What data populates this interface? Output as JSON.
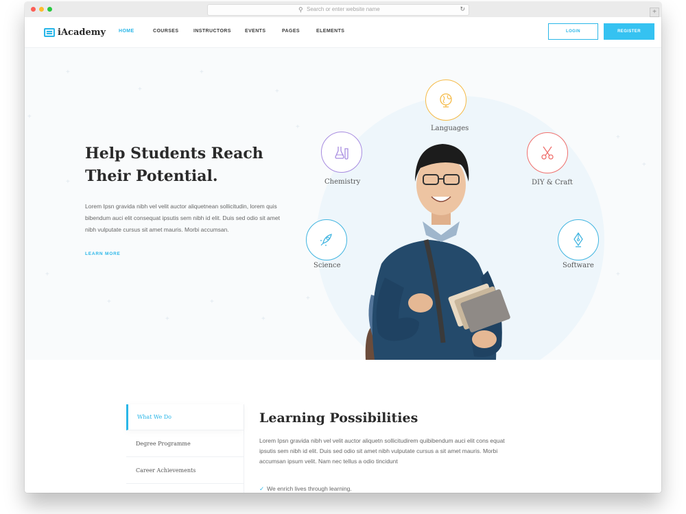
{
  "browser": {
    "address_placeholder": "Search or enter website name",
    "new_tab": "+"
  },
  "nav": {
    "brand": "iAcademy",
    "items": [
      {
        "label": "HOME",
        "active": true
      },
      {
        "label": "COURSES"
      },
      {
        "label": "INSTRUCTORS"
      },
      {
        "label": "EVENTS"
      },
      {
        "label": "PAGES"
      },
      {
        "label": "ELEMENTS"
      }
    ],
    "login_label": "LOGIN",
    "register_label": "REGISTER"
  },
  "hero": {
    "title_line1": "Help Students Reach",
    "title_line2": "Their Potential.",
    "text": "Lorem Ipsn gravida nibh vel velit auctor aliquetnean sollicitudin, lorem quis bibendum auci elit consequat ipsutis sem nibh id elit. Duis sed odio sit amet nibh vulputate cursus sit amet mauris. Morbi accumsan.",
    "cta": "LEARN MORE",
    "categories": [
      {
        "label": "Languages",
        "icon": "globe-icon",
        "color": "#f5b944"
      },
      {
        "label": "Chemistry",
        "icon": "flask-icon",
        "color": "#a78be0"
      },
      {
        "label": "DIY & Craft",
        "icon": "scissors-icon",
        "color": "#ef6f6c"
      },
      {
        "label": "Science",
        "icon": "rocket-icon",
        "color": "#3fb4e0"
      },
      {
        "label": "Software",
        "icon": "pen-nib-icon",
        "color": "#3fb4e0"
      }
    ]
  },
  "learning": {
    "tabs": [
      {
        "label": "What We Do",
        "active": true
      },
      {
        "label": "Degree Programme"
      },
      {
        "label": "Career Achievements"
      }
    ],
    "title": "Learning Possibilities",
    "text": "Lorem Ipsn gravida nibh vel velit auctor aliquetn sollicitudirem quibibendum auci elit cons equat ipsutis sem nibh id elit. Duis sed odio sit amet nibh vulputate cursus a sit amet mauris. Morbi accumsan ipsum velit. Nam nec tellus a odio tincidunt",
    "check_item": "We enrich lives through learning."
  },
  "colors": {
    "accent": "#29b6e8",
    "text_dark": "#2a2a2a"
  }
}
